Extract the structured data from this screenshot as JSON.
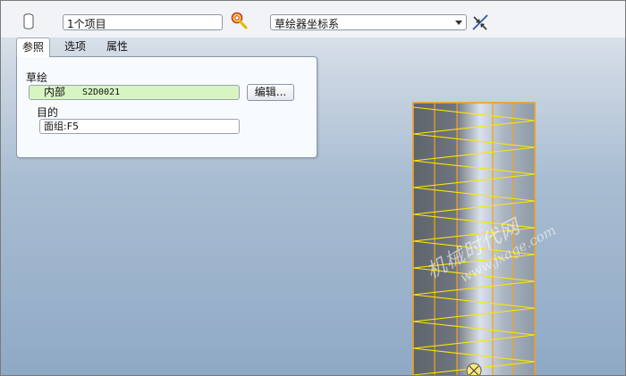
{
  "toolbar": {
    "selection_value": "1个项目",
    "coord_system_value": "草绘器坐标系",
    "icons": [
      "cylinder-icon",
      "lock-collector-icon",
      "dropdown-arrow-icon",
      "flip-direction-icon"
    ]
  },
  "tabs": [
    {
      "label": "参照",
      "active": true
    },
    {
      "label": "选项",
      "active": false
    },
    {
      "label": "属性",
      "active": false
    }
  ],
  "references": {
    "sketch_label": "草绘",
    "sketch_kind": "内部",
    "sketch_name": "S2D0021",
    "edit_button": "编辑...",
    "target_label": "目的",
    "target_value": "面组:F5"
  },
  "watermark": {
    "line1": "机械时代网",
    "line2": "www.jxage.com"
  },
  "colors": {
    "sketch_field_bg": "#d7f5c2",
    "spring_wire": "#ffe600",
    "cylinder_edge": "#f0a020",
    "viewport_top": "#e8edf3",
    "viewport_bottom": "#8fa9c5"
  }
}
